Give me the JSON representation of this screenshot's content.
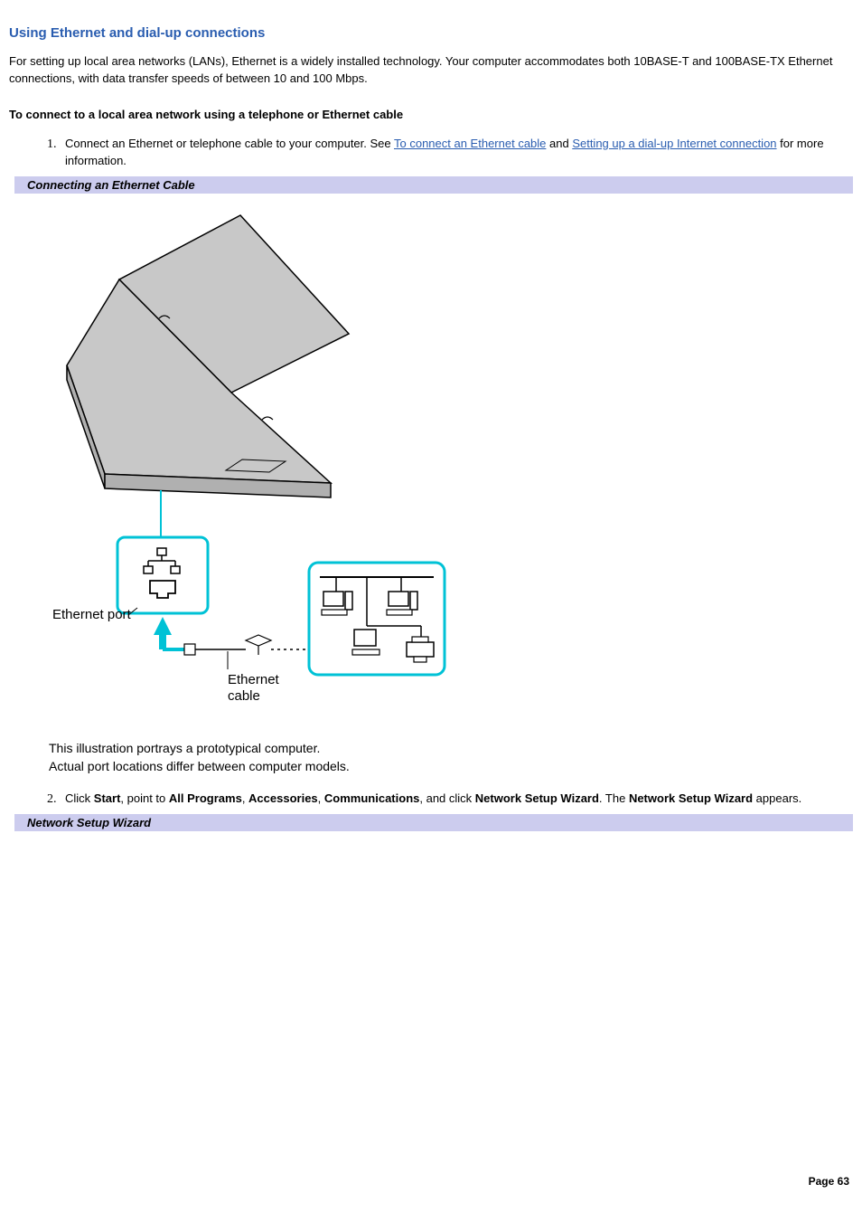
{
  "title": "Using Ethernet and dial-up connections",
  "intro": "For setting up local area networks (LANs), Ethernet is a widely installed technology. Your computer accommodates both 10BASE-T and 100BASE-TX Ethernet connections, with data transfer speeds of between 10 and 100 Mbps.",
  "sub_heading": "To connect to a local area network using a telephone or Ethernet cable",
  "steps": {
    "1": {
      "pre": "Connect an Ethernet or telephone cable to your computer. See ",
      "link1": "To connect an Ethernet cable",
      "mid": " and ",
      "link2": "Setting up a dial-up Internet connection",
      "post": " for more information."
    },
    "2": {
      "t1": "Click ",
      "b1": "Start",
      "t2": ", point to ",
      "b2": "All Programs",
      "t3": ", ",
      "b3": "Accessories",
      "t4": ", ",
      "b4": "Communications",
      "t5": ", and click ",
      "b5": "Network Setup Wizard",
      "t6": ". The ",
      "b6": "Network Setup Wizard",
      "t7": " appears."
    }
  },
  "callouts": {
    "ethernet_cable": "Connecting an Ethernet Cable",
    "wizard": "Network Setup Wizard"
  },
  "figure": {
    "port_label": "Ethernet port",
    "cable_label_line1": "Ethernet",
    "cable_label_line2": "cable",
    "caption_line1": "This illustration portrays a prototypical computer.",
    "caption_line2": "Actual port locations differ between computer models."
  },
  "footer": "Page 63"
}
